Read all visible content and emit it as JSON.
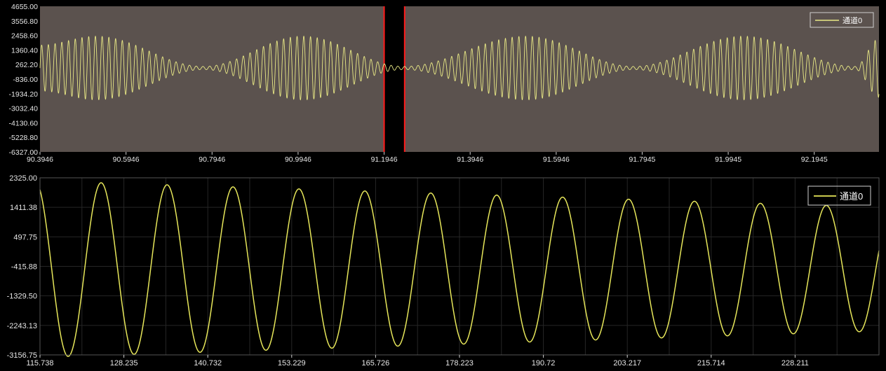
{
  "chart_data": [
    {
      "type": "line",
      "role": "overview",
      "title": "",
      "xlabel": "",
      "ylabel": "",
      "xlim": [
        90.3946,
        92.345
      ],
      "ylim": [
        -6327.0,
        4655.0
      ],
      "x_ticks": [
        "90.3946",
        "90.5946",
        "90.7946",
        "90.9946",
        "91.1946",
        "91.3946",
        "91.5946",
        "91.7945",
        "91.9945",
        "92.1945"
      ],
      "y_ticks": [
        "4655.00",
        "3556.80",
        "2458.60",
        "1360.40",
        "262.20",
        "-836.00",
        "-1934.20",
        "-3032.40",
        "-4130.60",
        "-5228.80",
        "-6327.00"
      ],
      "grid": false,
      "legend": "top-right",
      "series": [
        {
          "name": "通道0",
          "waveform": {
            "amplitude_peak": 2400,
            "envelope": "beating",
            "envelope_nodes_x": [
              90.775,
              91.24,
              91.775,
              92.29
            ],
            "envelope_maxima_x": [
              90.525,
              91.005,
              91.525,
              92.03
            ],
            "min_amplitude": 120,
            "cycles_per_unit": 64
          }
        }
      ],
      "selection": {
        "x_start": 91.1946,
        "x_end": 91.2423
      },
      "colors": {
        "background": "#5b524e",
        "line": "#eaea86",
        "selection_bg": "#000000",
        "selection_edge": "#ff1a1a"
      }
    },
    {
      "type": "line",
      "role": "detail",
      "title": "",
      "xlabel": "",
      "ylabel": "",
      "xlim": [
        115.738,
        240.708
      ],
      "ylim": [
        -3156.75,
        2325.0
      ],
      "x_ticks": [
        "115.738",
        "128.235",
        "140.732",
        "153.229",
        "165.726",
        "178.223",
        "190.72",
        "203.217",
        "215.714",
        "228.211"
      ],
      "y_ticks": [
        "2325.00",
        "1411.38",
        "497.75",
        "-415.88",
        "-1329.50",
        "-2243.13",
        "-3156.75"
      ],
      "grid": true,
      "legend": "top-right",
      "series": [
        {
          "name": "通道0",
          "waveform": {
            "period": 9.82,
            "first_peak_x": 124.85,
            "start_amplitude": 2730,
            "end_amplitude": 1920,
            "offset": -500
          }
        }
      ],
      "colors": {
        "background": "#000000",
        "line": "#e6e65a",
        "grid": "#262626"
      }
    }
  ]
}
